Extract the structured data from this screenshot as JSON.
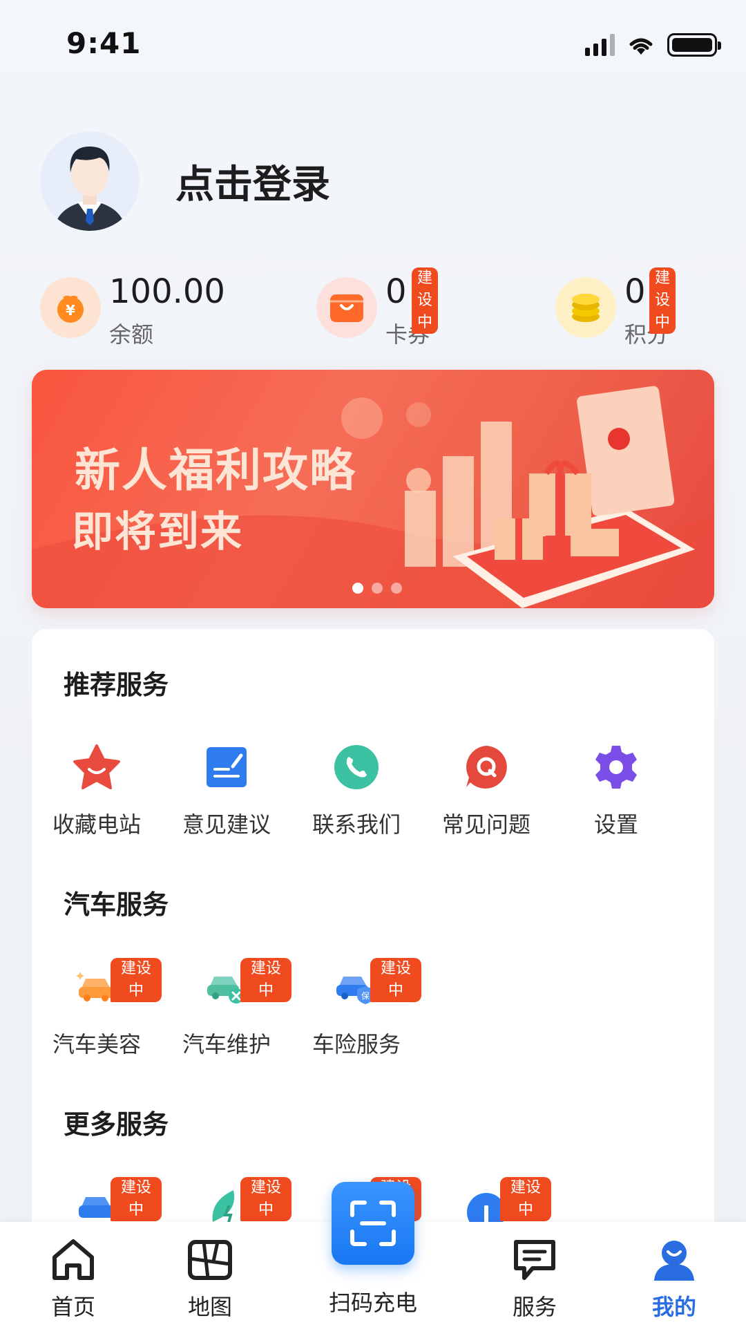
{
  "status_bar": {
    "time": "9:41"
  },
  "profile": {
    "login_text": "点击登录"
  },
  "stats": [
    {
      "value": "100.00",
      "label": "余额",
      "badge": ""
    },
    {
      "value": "0",
      "label": "卡券",
      "badge": "建设中"
    },
    {
      "value": "0",
      "label": "积分",
      "badge": "建设中"
    }
  ],
  "banner": {
    "line1": "新人福利攻略",
    "line2": "即将到来",
    "active_dot": 1,
    "dot_count": 3
  },
  "sections": {
    "recommended": {
      "title": "推荐服务",
      "items": [
        {
          "label": "收藏电站",
          "icon": "star-icon"
        },
        {
          "label": "意见建议",
          "icon": "feedback-icon"
        },
        {
          "label": "联系我们",
          "icon": "phone-icon"
        },
        {
          "label": "常见问题",
          "icon": "faq-icon"
        },
        {
          "label": "设置",
          "icon": "gear-icon"
        }
      ]
    },
    "car": {
      "title": "汽车服务",
      "badge": "建设中",
      "items": [
        {
          "label": "汽车美容",
          "icon": "car-beauty-icon"
        },
        {
          "label": "汽车维护",
          "icon": "car-repair-icon"
        },
        {
          "label": "车险服务",
          "icon": "car-insurance-icon"
        }
      ]
    },
    "more": {
      "title": "更多服务",
      "badge": "建设中"
    }
  },
  "tabbar": {
    "home": "首页",
    "map": "地图",
    "scan": "扫码充电",
    "service": "服务",
    "mine": "我的"
  },
  "colors": {
    "accent": "#2a6de0",
    "badge": "#f04a1f",
    "banner": "#f9553e"
  }
}
